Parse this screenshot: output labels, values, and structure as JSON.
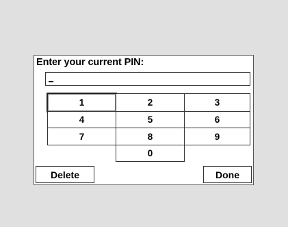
{
  "dialog": {
    "title": "Enter your current PIN:",
    "pin_value": "",
    "cursor_glyph": "_"
  },
  "keypad": {
    "keys": [
      "1",
      "2",
      "3",
      "4",
      "5",
      "6",
      "7",
      "8",
      "9",
      "0"
    ],
    "focused_key": "1"
  },
  "actions": {
    "delete_label": "Delete",
    "done_label": "Done"
  },
  "colors": {
    "background": "#e0e0e0",
    "panel": "#ffffff",
    "border": "#333333"
  }
}
